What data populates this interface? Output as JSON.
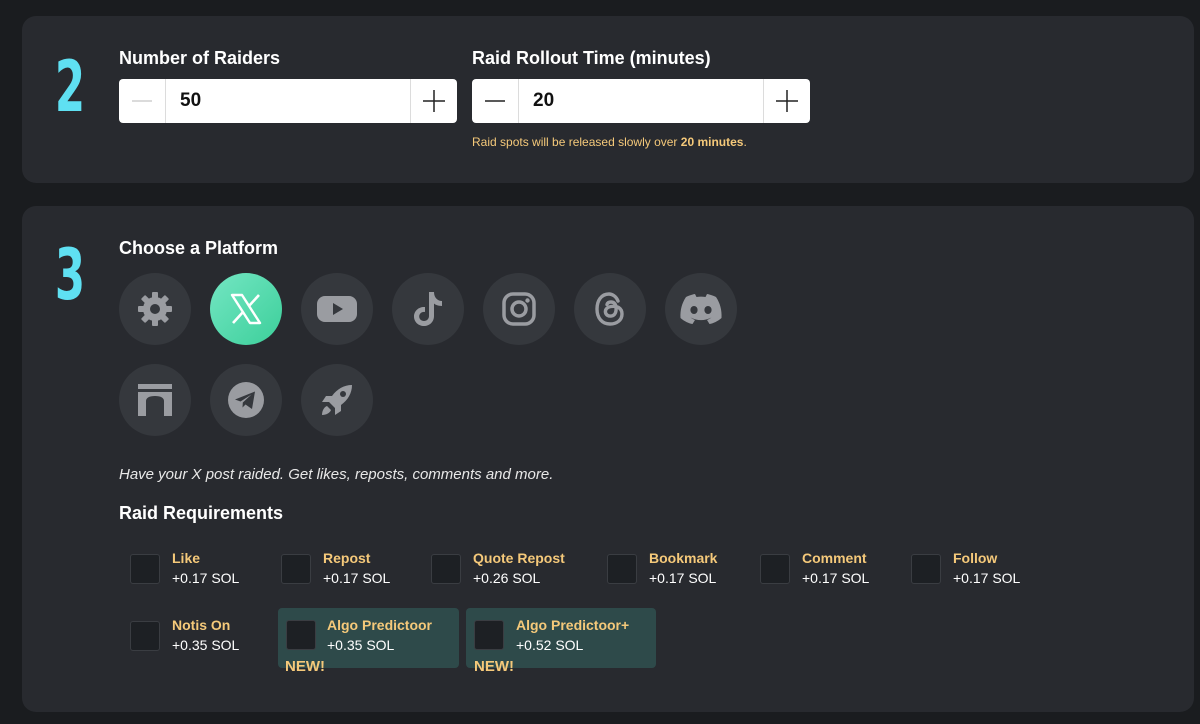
{
  "step2": {
    "number": "2",
    "raiders": {
      "label": "Number of Raiders",
      "value": "50"
    },
    "rollout": {
      "label": "Raid Rollout Time (minutes)",
      "value": "20"
    },
    "hint_prefix": "Raid spots will be released slowly over ",
    "hint_emphasis": "20 minutes",
    "hint_suffix": "."
  },
  "step3": {
    "number": "3",
    "title": "Choose a Platform",
    "platforms": [
      {
        "icon": "gear-icon",
        "active": false
      },
      {
        "icon": "x-logo-icon",
        "active": true
      },
      {
        "icon": "youtube-icon",
        "active": false
      },
      {
        "icon": "tiktok-icon",
        "active": false
      },
      {
        "icon": "instagram-icon",
        "active": false
      },
      {
        "icon": "threads-icon",
        "active": false
      },
      {
        "icon": "discord-icon",
        "active": false
      },
      {
        "icon": "storefront-icon",
        "active": false
      },
      {
        "icon": "telegram-icon",
        "active": false
      },
      {
        "icon": "rocket-icon",
        "active": false
      }
    ],
    "description": "Have your X post raided. Get likes, reposts, comments and more.",
    "requirements_title": "Raid Requirements",
    "requirements": [
      {
        "name": "Like",
        "price": "+0.17 SOL"
      },
      {
        "name": "Repost",
        "price": "+0.17 SOL"
      },
      {
        "name": "Quote Repost",
        "price": "+0.26 SOL"
      },
      {
        "name": "Bookmark",
        "price": "+0.17 SOL"
      },
      {
        "name": "Comment",
        "price": "+0.17 SOL"
      },
      {
        "name": "Follow",
        "price": "+0.17 SOL"
      },
      {
        "name": "Notis On",
        "price": "+0.35 SOL"
      },
      {
        "name": "Algo Predictoor",
        "price": "+0.35 SOL",
        "badge": "NEW!"
      },
      {
        "name": "Algo Predictoor+",
        "price": "+0.52 SOL",
        "badge": "NEW!"
      }
    ]
  },
  "colors": {
    "accent_number": "#5fe0f2",
    "requirement_name": "#f5c97a",
    "active_platform": "#4fd9ad",
    "highlight_row": "#2e4a4a"
  }
}
